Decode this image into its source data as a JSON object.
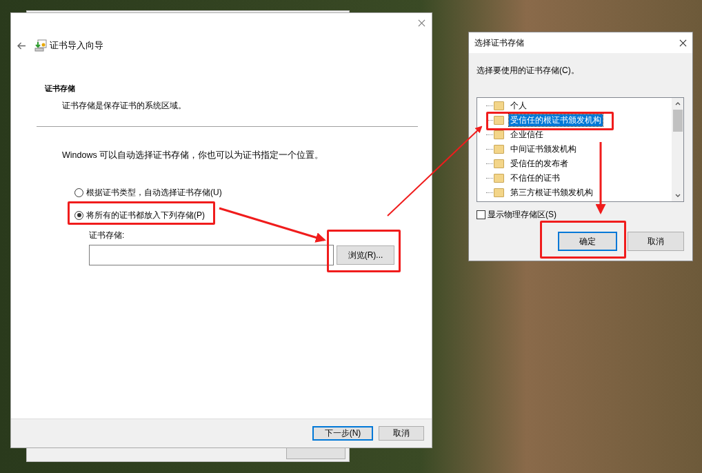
{
  "wizard": {
    "title": "证书导入向导",
    "section_title": "证书存储",
    "section_desc": "证书存储是保存证书的系统区域。",
    "intro": "Windows 可以自动选择证书存储，你也可以为证书指定一个位置。",
    "options": [
      {
        "label": "根据证书类型，自动选择证书存储(U)",
        "selected": false
      },
      {
        "label": "将所有的证书都放入下列存储(P)",
        "selected": true
      }
    ],
    "store_label": "证书存储:",
    "browse_button": "浏览(R)...",
    "buttons": [
      {
        "label": "下一步(N)",
        "default": true
      },
      {
        "label": "取消",
        "default": false
      }
    ]
  },
  "dialog": {
    "title": "选择证书存储",
    "prompt": "选择要使用的证书存储(C)。",
    "stores": [
      {
        "label": "个人",
        "selected": false
      },
      {
        "label": "受信任的根证书颁发机构",
        "selected": true
      },
      {
        "label": "企业信任",
        "selected": false
      },
      {
        "label": "中间证书颁发机构",
        "selected": false
      },
      {
        "label": "受信任的发布者",
        "selected": false
      },
      {
        "label": "不信任的证书",
        "selected": false
      },
      {
        "label": "第三方根证书颁发机构",
        "selected": false
      }
    ],
    "show_physical": {
      "label": "显示物理存储区(S)",
      "checked": false
    },
    "buttons": [
      {
        "label": "确定",
        "default": true
      },
      {
        "label": "取消",
        "default": false
      }
    ]
  }
}
